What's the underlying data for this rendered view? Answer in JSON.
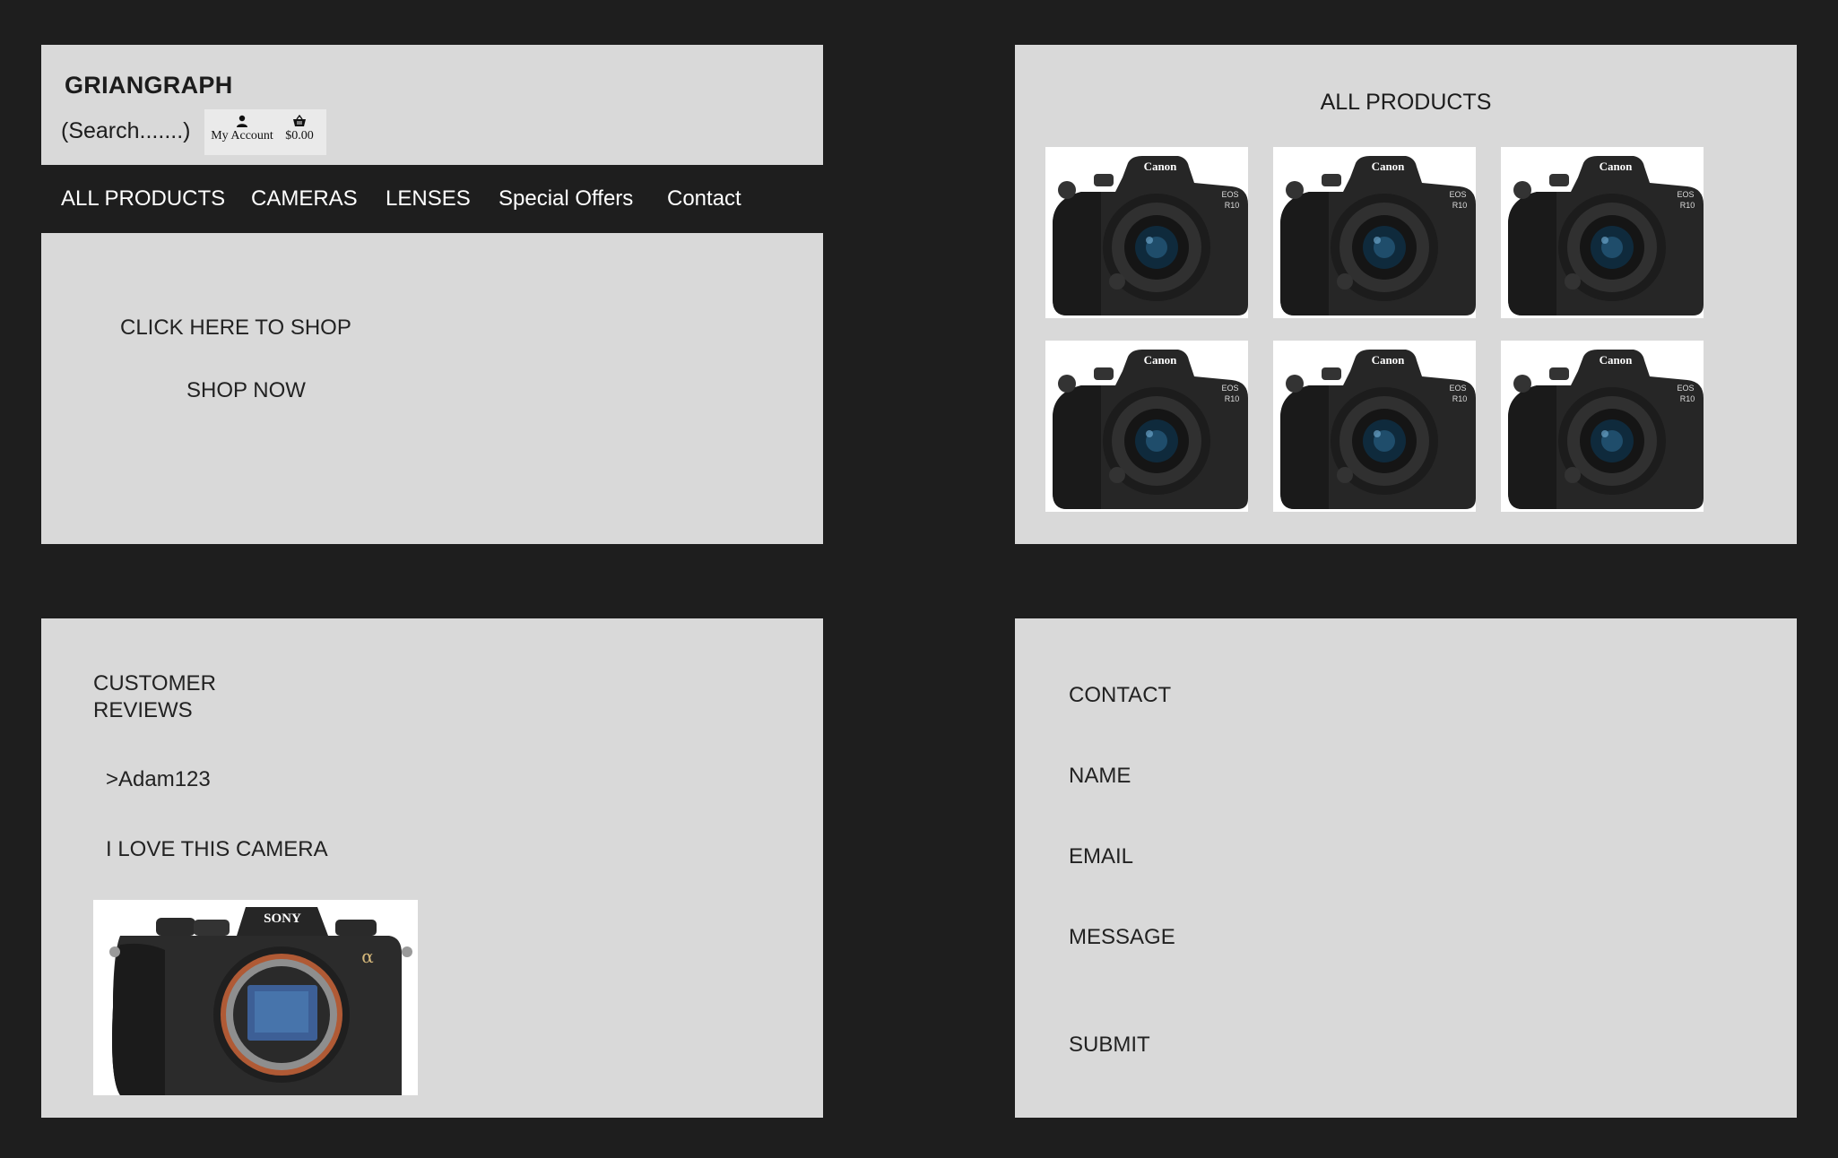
{
  "header": {
    "brand": "GRIANGRAPH",
    "search_label": "(Search.......)",
    "account_label": "My Account",
    "cart_label": "$0.00"
  },
  "nav": {
    "items": [
      {
        "label": "ALL PRODUCTS"
      },
      {
        "label": "CAMERAS"
      },
      {
        "label": "LENSES"
      },
      {
        "label": "Special Offers"
      },
      {
        "label": "Contact"
      }
    ]
  },
  "hero": {
    "headline": "CLICK HERE TO SHOP",
    "cta": "SHOP NOW"
  },
  "products": {
    "title": "ALL PRODUCTS",
    "items": [
      {
        "brand": "Canon",
        "model": "EOS R10"
      },
      {
        "brand": "Canon",
        "model": "EOS R10"
      },
      {
        "brand": "Canon",
        "model": "EOS R10"
      },
      {
        "brand": "Canon",
        "model": "EOS R10"
      },
      {
        "brand": "Canon",
        "model": "EOS R10"
      },
      {
        "brand": "Canon",
        "model": "EOS R10"
      }
    ]
  },
  "reviews": {
    "title_line1": "CUSTOMER",
    "title_line2": "REVIEWS",
    "author": ">Adam123",
    "text": "I LOVE THIS CAMERA",
    "camera_brand": "SONY",
    "camera_mark": "α"
  },
  "contact": {
    "title": "CONTACT",
    "name_label": "NAME",
    "email_label": "EMAIL",
    "message_label": "MESSAGE",
    "submit_label": "SUBMIT"
  },
  "colors": {
    "background": "#1e1e1e",
    "panel": "#d9d9d9",
    "nav_bar": "#1e1e1e",
    "nav_text": "#ffffff"
  },
  "icons": [
    "user-icon",
    "basket-icon"
  ]
}
